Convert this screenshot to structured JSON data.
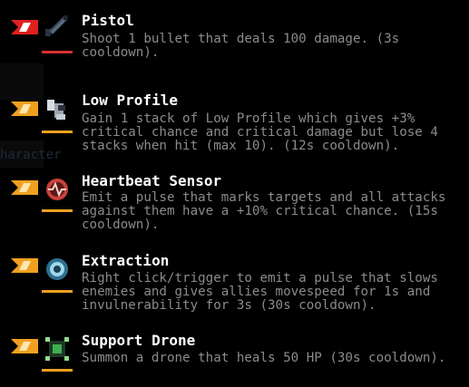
{
  "colors": {
    "background": "#000000",
    "title": "#ffffff",
    "description": "#8b8b8b",
    "primary_flag": "#e02020",
    "primary_underline": "#d83030",
    "utility_flag": "#f0a020",
    "utility_underline": "#f0a020"
  },
  "background_text": "haracter",
  "skills": [
    {
      "slot": "primary",
      "name": "Pistol",
      "description": "Shoot 1 bullet that deals 100 damage. (3s cooldown).",
      "icon": "pistol-icon"
    },
    {
      "slot": "utility",
      "name": "Low Profile",
      "description": "Gain 1 stack of Low Profile which gives +3% critical chance and critical damage but lose 4 stacks when hit (max 10). (12s cooldown).",
      "icon": "low-profile-icon"
    },
    {
      "slot": "utility",
      "name": "Heartbeat Sensor",
      "description": "Emit a pulse that marks targets and all attacks against them have a +10% critical chance. (15s cooldown).",
      "icon": "heartbeat-sensor-icon"
    },
    {
      "slot": "utility",
      "name": "Extraction",
      "description": "Right click/trigger to emit a pulse that slows enemies and gives allies movespeed for 1s and invulnerability for 3s (30s cooldown).",
      "icon": "extraction-icon"
    },
    {
      "slot": "utility",
      "name": "Support Drone",
      "description": "Summon a drone that heals 50 HP (30s cooldown).",
      "icon": "support-drone-icon"
    }
  ]
}
